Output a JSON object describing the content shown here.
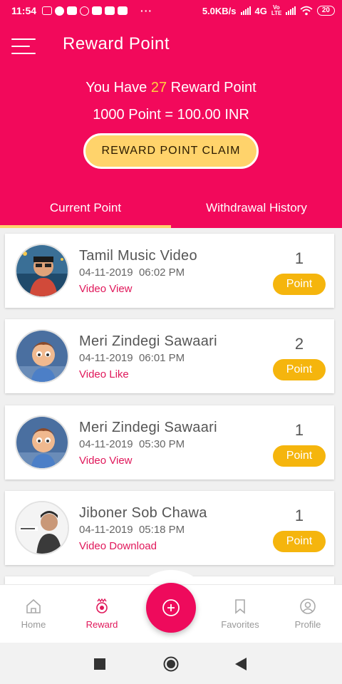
{
  "status_bar": {
    "time": "11:54",
    "net_speed": "5.0KB/s",
    "network": "4G",
    "carrier_tag": "Vo LTE",
    "battery": "20",
    "overflow": "···"
  },
  "header": {
    "title": "Reward Point",
    "reward_prefix": "You Have",
    "reward_points": "27",
    "reward_suffix": "Reward Point",
    "conversion_rate": "1000 Point = 100.00 INR",
    "claim_button": "REWARD POINT CLAIM"
  },
  "tabs": [
    {
      "label": "Current Point",
      "active": true
    },
    {
      "label": "Withdrawal History",
      "active": false
    }
  ],
  "rewards": [
    {
      "title": "Tamil Music Video",
      "date": "04-11-2019",
      "time": "06:02 PM",
      "action": "Video View",
      "points": "1",
      "badge": "Point",
      "avatar": "avatar-cartoon-man"
    },
    {
      "title": "Meri Zindegi Sawaari",
      "date": "04-11-2019",
      "time": "06:01 PM",
      "action": "Video Like",
      "points": "2",
      "badge": "Point",
      "avatar": "avatar-cartoon-boy"
    },
    {
      "title": "Meri Zindegi Sawaari",
      "date": "04-11-2019",
      "time": "05:30 PM",
      "action": "Video View",
      "points": "1",
      "badge": "Point",
      "avatar": "avatar-cartoon-boy"
    },
    {
      "title": "Jiboner Sob Chawa",
      "date": "04-11-2019",
      "time": "05:18 PM",
      "action": "Video Download",
      "points": "1",
      "badge": "Point",
      "avatar": "avatar-photo-man"
    }
  ],
  "bottom_nav": {
    "items": [
      {
        "label": "Home",
        "icon": "home-icon",
        "active": false
      },
      {
        "label": "Reward",
        "icon": "reward-icon",
        "active": true
      },
      {
        "label": "Favorites",
        "icon": "bookmark-icon",
        "active": false
      },
      {
        "label": "Profile",
        "icon": "profile-icon",
        "active": false
      }
    ],
    "fab_icon": "plus-circle-icon"
  },
  "colors": {
    "primary": "#f2095b",
    "accent_yellow": "#ffd36b",
    "badge_orange": "#f5b50d",
    "action_pink": "#e0175a"
  }
}
